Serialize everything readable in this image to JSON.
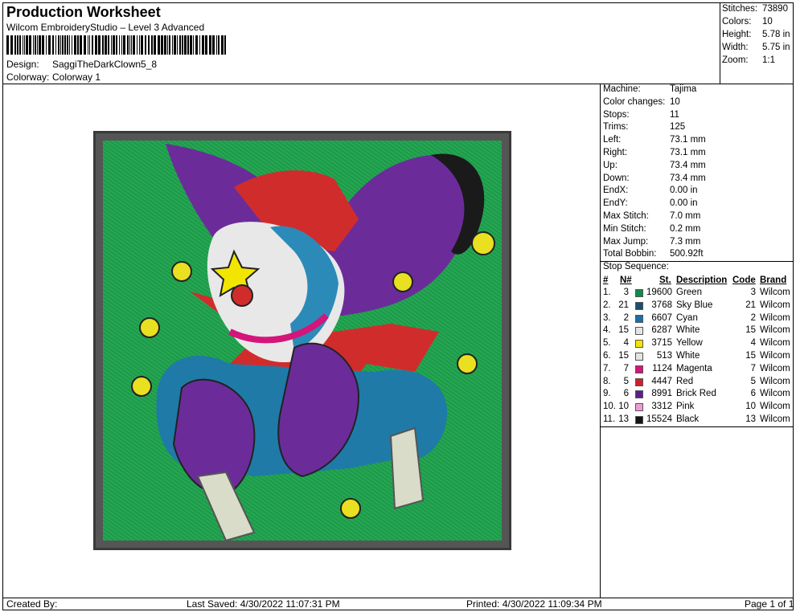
{
  "header": {
    "title": "Production Worksheet",
    "software": "Wilcom EmbroideryStudio – Level 3 Advanced",
    "design_label": "Design:",
    "design_value": "SaggiTheDarkClown5_8",
    "colorway_label": "Colorway:",
    "colorway_value": "Colorway 1"
  },
  "summary": [
    {
      "label": "Stitches:",
      "value": "73890"
    },
    {
      "label": "Colors:",
      "value": "10"
    },
    {
      "label": "Height:",
      "value": "5.78 in"
    },
    {
      "label": "Width:",
      "value": "5.75 in"
    },
    {
      "label": "Zoom:",
      "value": "1:1"
    }
  ],
  "machine_info": [
    {
      "label": "Machine:",
      "value": "Tajima"
    },
    {
      "label": "Color changes:",
      "value": "10"
    },
    {
      "label": "Stops:",
      "value": "11"
    },
    {
      "label": "Trims:",
      "value": "125"
    },
    {
      "label": "Left:",
      "value": "73.1 mm"
    },
    {
      "label": "Right:",
      "value": "73.1 mm"
    },
    {
      "label": "Up:",
      "value": "73.4 mm"
    },
    {
      "label": "Down:",
      "value": "73.4 mm"
    },
    {
      "label": "EndX:",
      "value": "0.00 in"
    },
    {
      "label": "EndY:",
      "value": "0.00 in"
    },
    {
      "label": "Max Stitch:",
      "value": "7.0 mm"
    },
    {
      "label": "Min Stitch:",
      "value": "0.2 mm"
    },
    {
      "label": "Max Jump:",
      "value": "7.3 mm"
    },
    {
      "label": "Total Bobbin:",
      "value": "500.92ft"
    }
  ],
  "stop_sequence": {
    "title": "Stop Sequence:",
    "headers": {
      "idx": "#",
      "n": "N#",
      "st": "St.",
      "desc": "Description",
      "code": "Code",
      "brand": "Brand"
    },
    "rows": [
      {
        "idx": "1.",
        "n": "3",
        "color": "#0f8a4a",
        "st": "19600",
        "desc": "Green",
        "code": "3",
        "brand": "Wilcom"
      },
      {
        "idx": "2.",
        "n": "21",
        "color": "#1c4e6e",
        "st": "3768",
        "desc": "Sky Blue",
        "code": "21",
        "brand": "Wilcom"
      },
      {
        "idx": "3.",
        "n": "2",
        "color": "#1a6fa8",
        "st": "6607",
        "desc": "Cyan",
        "code": "2",
        "brand": "Wilcom"
      },
      {
        "idx": "4.",
        "n": "15",
        "color": "#e4e4e4",
        "st": "6287",
        "desc": "White",
        "code": "15",
        "brand": "Wilcom"
      },
      {
        "idx": "5.",
        "n": "4",
        "color": "#f2e500",
        "st": "3715",
        "desc": "Yellow",
        "code": "4",
        "brand": "Wilcom"
      },
      {
        "idx": "6.",
        "n": "15",
        "color": "#e4e4e4",
        "st": "513",
        "desc": "White",
        "code": "15",
        "brand": "Wilcom"
      },
      {
        "idx": "7.",
        "n": "7",
        "color": "#d4157a",
        "st": "1124",
        "desc": "Magenta",
        "code": "7",
        "brand": "Wilcom"
      },
      {
        "idx": "8.",
        "n": "5",
        "color": "#d01f2a",
        "st": "4447",
        "desc": "Red",
        "code": "5",
        "brand": "Wilcom"
      },
      {
        "idx": "9.",
        "n": "6",
        "color": "#5b1f8a",
        "st": "8991",
        "desc": "Brick Red",
        "code": "6",
        "brand": "Wilcom"
      },
      {
        "idx": "10.",
        "n": "10",
        "color": "#f19ad8",
        "st": "3312",
        "desc": "Pink",
        "code": "10",
        "brand": "Wilcom"
      },
      {
        "idx": "11.",
        "n": "13",
        "color": "#151515",
        "st": "15524",
        "desc": "Black",
        "code": "13",
        "brand": "Wilcom"
      }
    ]
  },
  "footer": {
    "created_by": "Created By:",
    "last_saved": "Last Saved: 4/30/2022 11:07:31 PM",
    "printed": "Printed: 4/30/2022 11:09:34 PM",
    "page": "Page 1 of 1"
  }
}
